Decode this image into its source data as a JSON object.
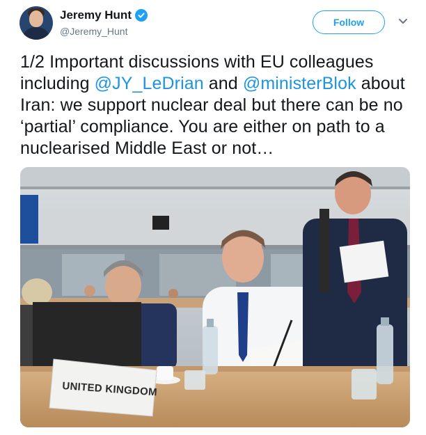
{
  "author": {
    "display_name": "Jeremy Hunt",
    "handle": "@Jeremy_Hunt",
    "verified": true,
    "avatar_icon": "profile-photo"
  },
  "actions": {
    "follow_label": "Follow",
    "more_icon": "chevron-down-icon"
  },
  "tweet": {
    "segments": [
      {
        "text": "1/2 Important discussions with EU colleagues including ",
        "mention": false
      },
      {
        "text": "@JY_LeDrian",
        "mention": true
      },
      {
        "text": " and ",
        "mention": false
      },
      {
        "text": "@ministerBlok",
        "mention": true
      },
      {
        "text": " about Iran: we support nuclear deal but there can be no ‘partial’ compliance. You are either on path to a nuclearised Middle East or not…",
        "mention": false
      }
    ]
  },
  "photo": {
    "placard_text": "UNITED KINGDOM"
  },
  "colors": {
    "accent": "#1da1f2",
    "mention": "#1b95e0",
    "secondary_text": "#657786"
  }
}
